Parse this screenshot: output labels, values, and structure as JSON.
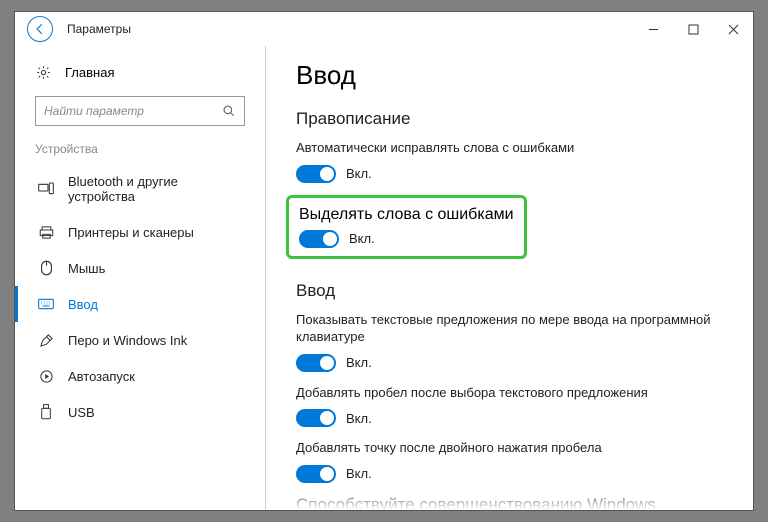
{
  "titlebar": {
    "title": "Параметры"
  },
  "sidebar": {
    "home": "Главная",
    "search_placeholder": "Найти параметр",
    "section": "Устройства",
    "items": [
      {
        "label": "Bluetooth и другие устройства"
      },
      {
        "label": "Принтеры и сканеры"
      },
      {
        "label": "Мышь"
      },
      {
        "label": "Ввод"
      },
      {
        "label": "Перо и Windows Ink"
      },
      {
        "label": "Автозапуск"
      },
      {
        "label": "USB"
      }
    ]
  },
  "content": {
    "title": "Ввод",
    "section1": {
      "heading": "Правописание",
      "s1": {
        "desc": "Автоматически исправлять слова с ошибками",
        "state": "Вкл."
      },
      "s2": {
        "desc": "Выделять слова с ошибками",
        "state": "Вкл."
      }
    },
    "section2": {
      "heading": "Ввод",
      "s1": {
        "desc": "Показывать текстовые предложения по мере ввода на программной клавиатуре",
        "state": "Вкл."
      },
      "s2": {
        "desc": "Добавлять пробел после выбора текстового предложения",
        "state": "Вкл."
      },
      "s3": {
        "desc": "Добавлять точку после двойного нажатия пробела",
        "state": "Вкл."
      }
    },
    "cutoff": "Способствуйте совершенствованию Windows"
  }
}
